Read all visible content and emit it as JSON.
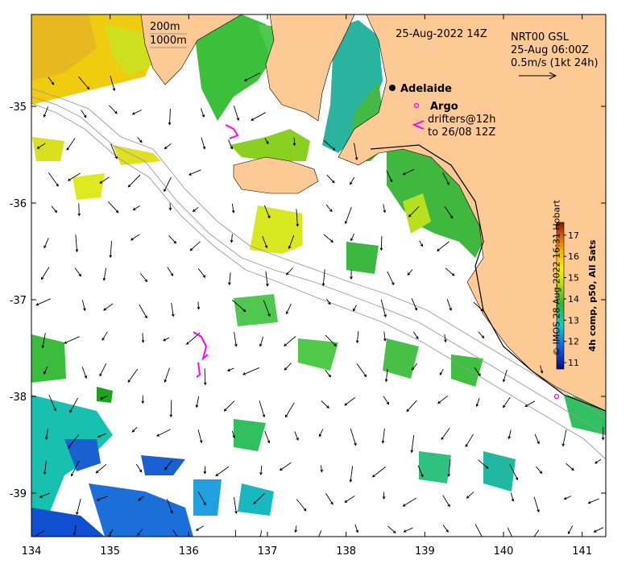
{
  "title": "25-Aug-2022 14Z",
  "model": {
    "line1": "NRT00 GSL",
    "line2": "25-Aug 06:00Z",
    "line3": "0.5m/s (1kt 24h)"
  },
  "isobath_legend": [
    "200m",
    "1000m"
  ],
  "city": "Adelaide",
  "legend": {
    "argo": "Argo",
    "drifters_line1": "drifters@12h",
    "drifters_line2": "to 26/08 12Z"
  },
  "colorbar": {
    "label": "4h comp, p50, All Sats",
    "ticks": [
      "11",
      "12",
      "13",
      "14",
      "15",
      "16",
      "17"
    ],
    "range": [
      10.7,
      17.6
    ]
  },
  "x_ticks": [
    "134",
    "135",
    "136",
    "137",
    "138",
    "139",
    "140",
    "141"
  ],
  "y_ticks": [
    "-35",
    "-36",
    "-37",
    "-38",
    "-39"
  ],
  "lon_range": [
    134,
    141.3
  ],
  "lat_range": [
    -39.45,
    -34.05
  ],
  "credit": "© IMOS 28-Aug-2022 16:31 Hobart",
  "colors": {
    "land": "#fdc994",
    "argo": "#ff00ff",
    "drifter": "#ff00ff"
  }
}
